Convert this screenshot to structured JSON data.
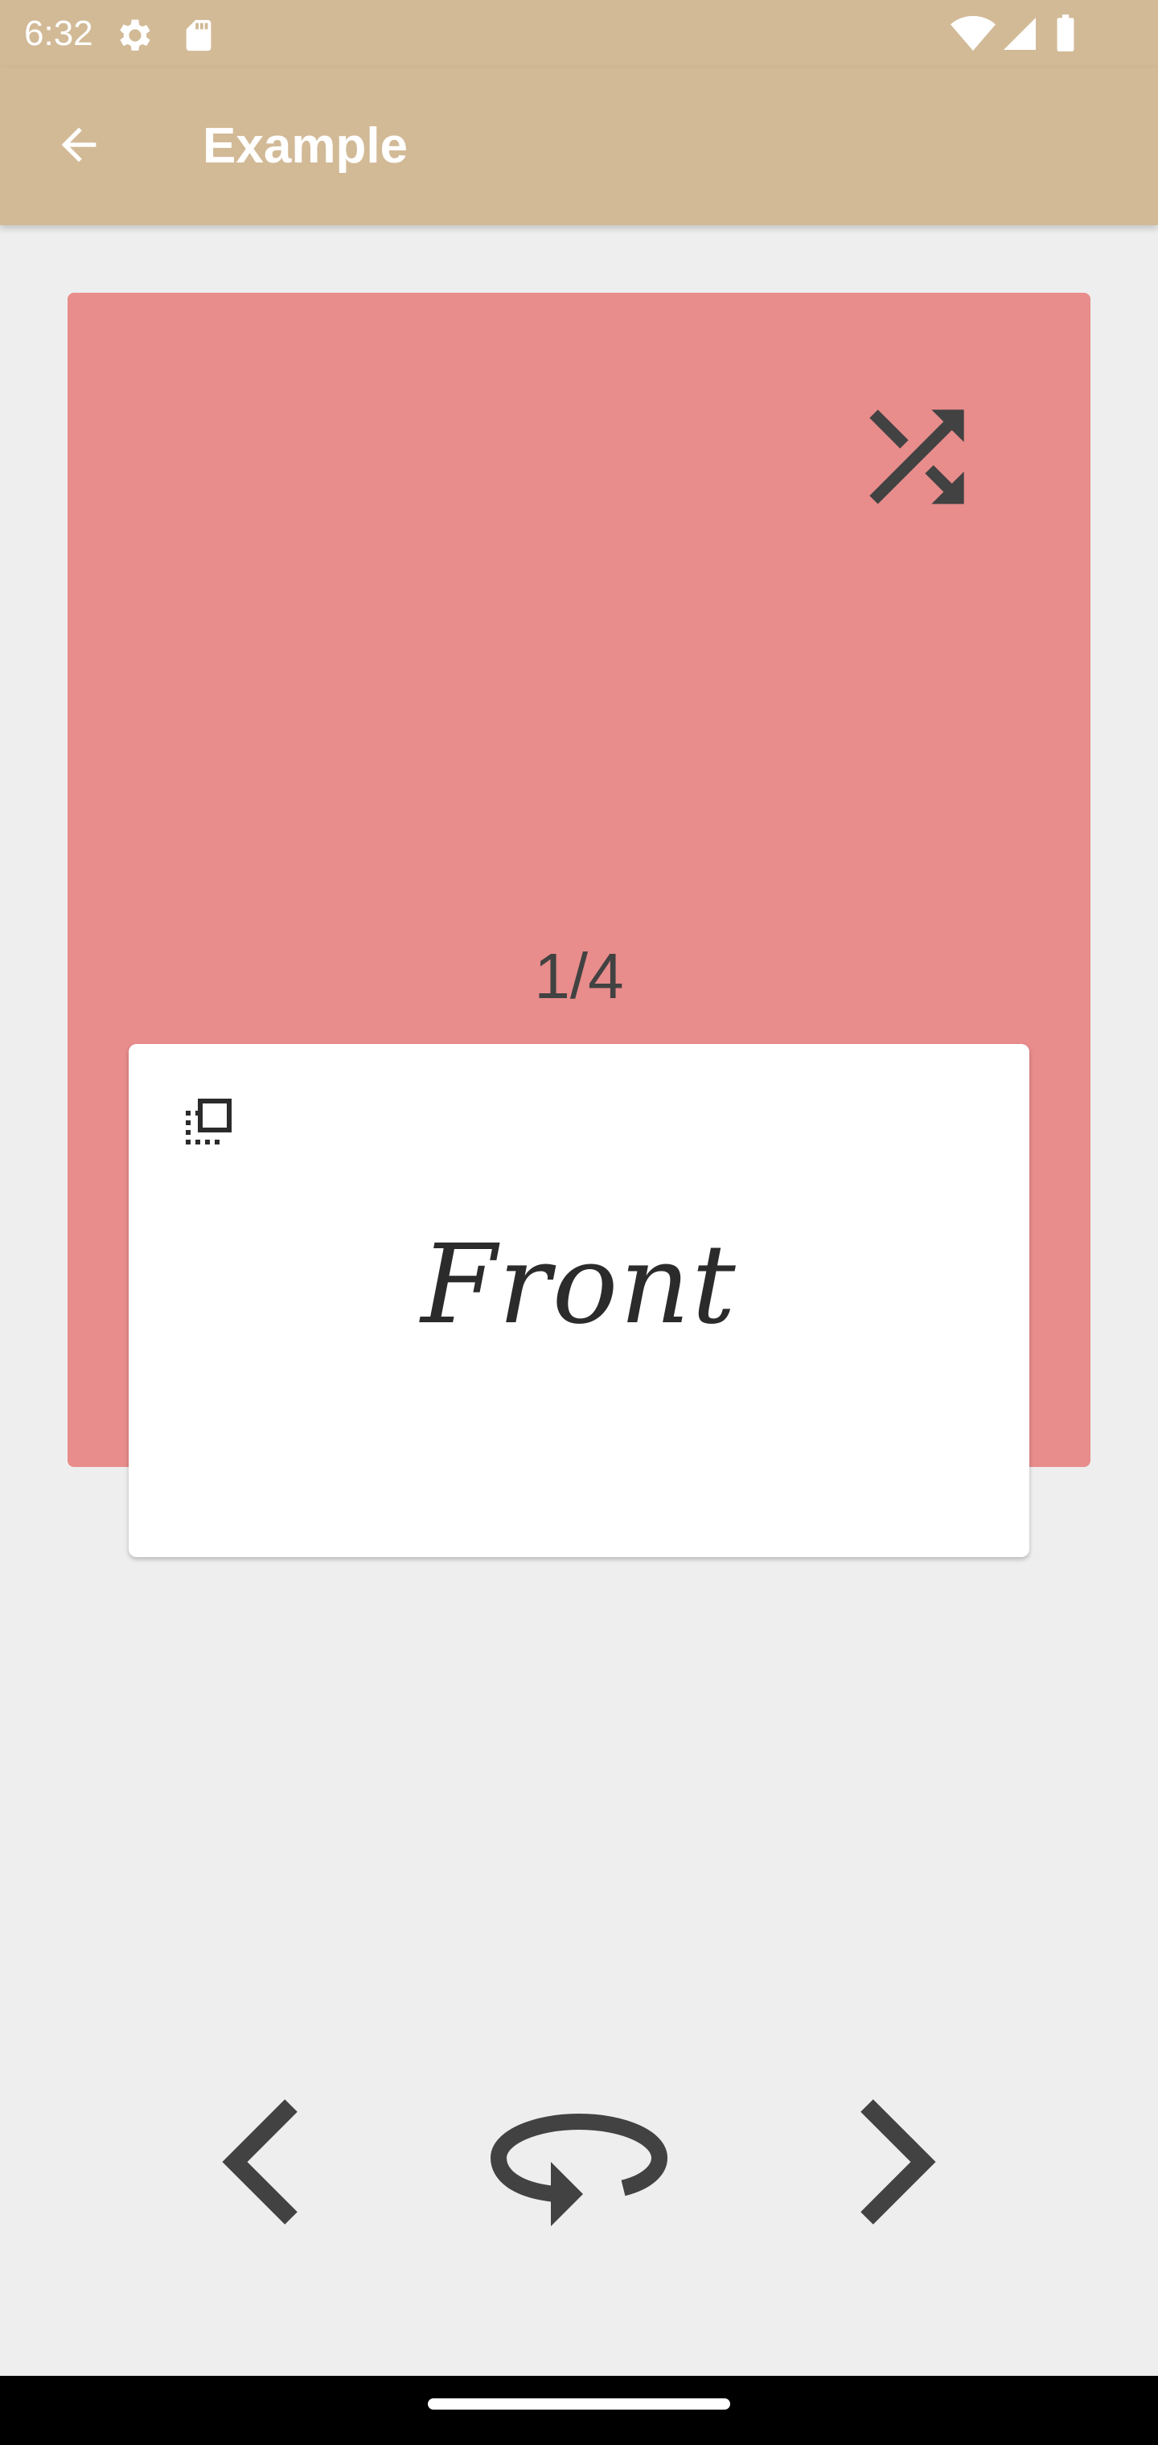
{
  "status_bar": {
    "time": "6:32",
    "icons": [
      "settings-icon",
      "sd-card-icon",
      "wifi-icon",
      "signal-icon",
      "battery-icon"
    ]
  },
  "app_bar": {
    "back_icon": "arrow-back-icon",
    "title": "Example"
  },
  "deck": {
    "shuffle_icon": "shuffle-icon",
    "counter": "1/4",
    "color": "#e88c8c"
  },
  "card": {
    "side_icon": "card-flip-icon",
    "text": "Front"
  },
  "controls": {
    "previous_icon": "chevron-left-icon",
    "flip_icon": "rotate-flip-icon",
    "next_icon": "chevron-right-icon"
  },
  "colors": {
    "app_bar": "#d2ba97",
    "background": "#eeeeee",
    "icon": "#424242"
  }
}
